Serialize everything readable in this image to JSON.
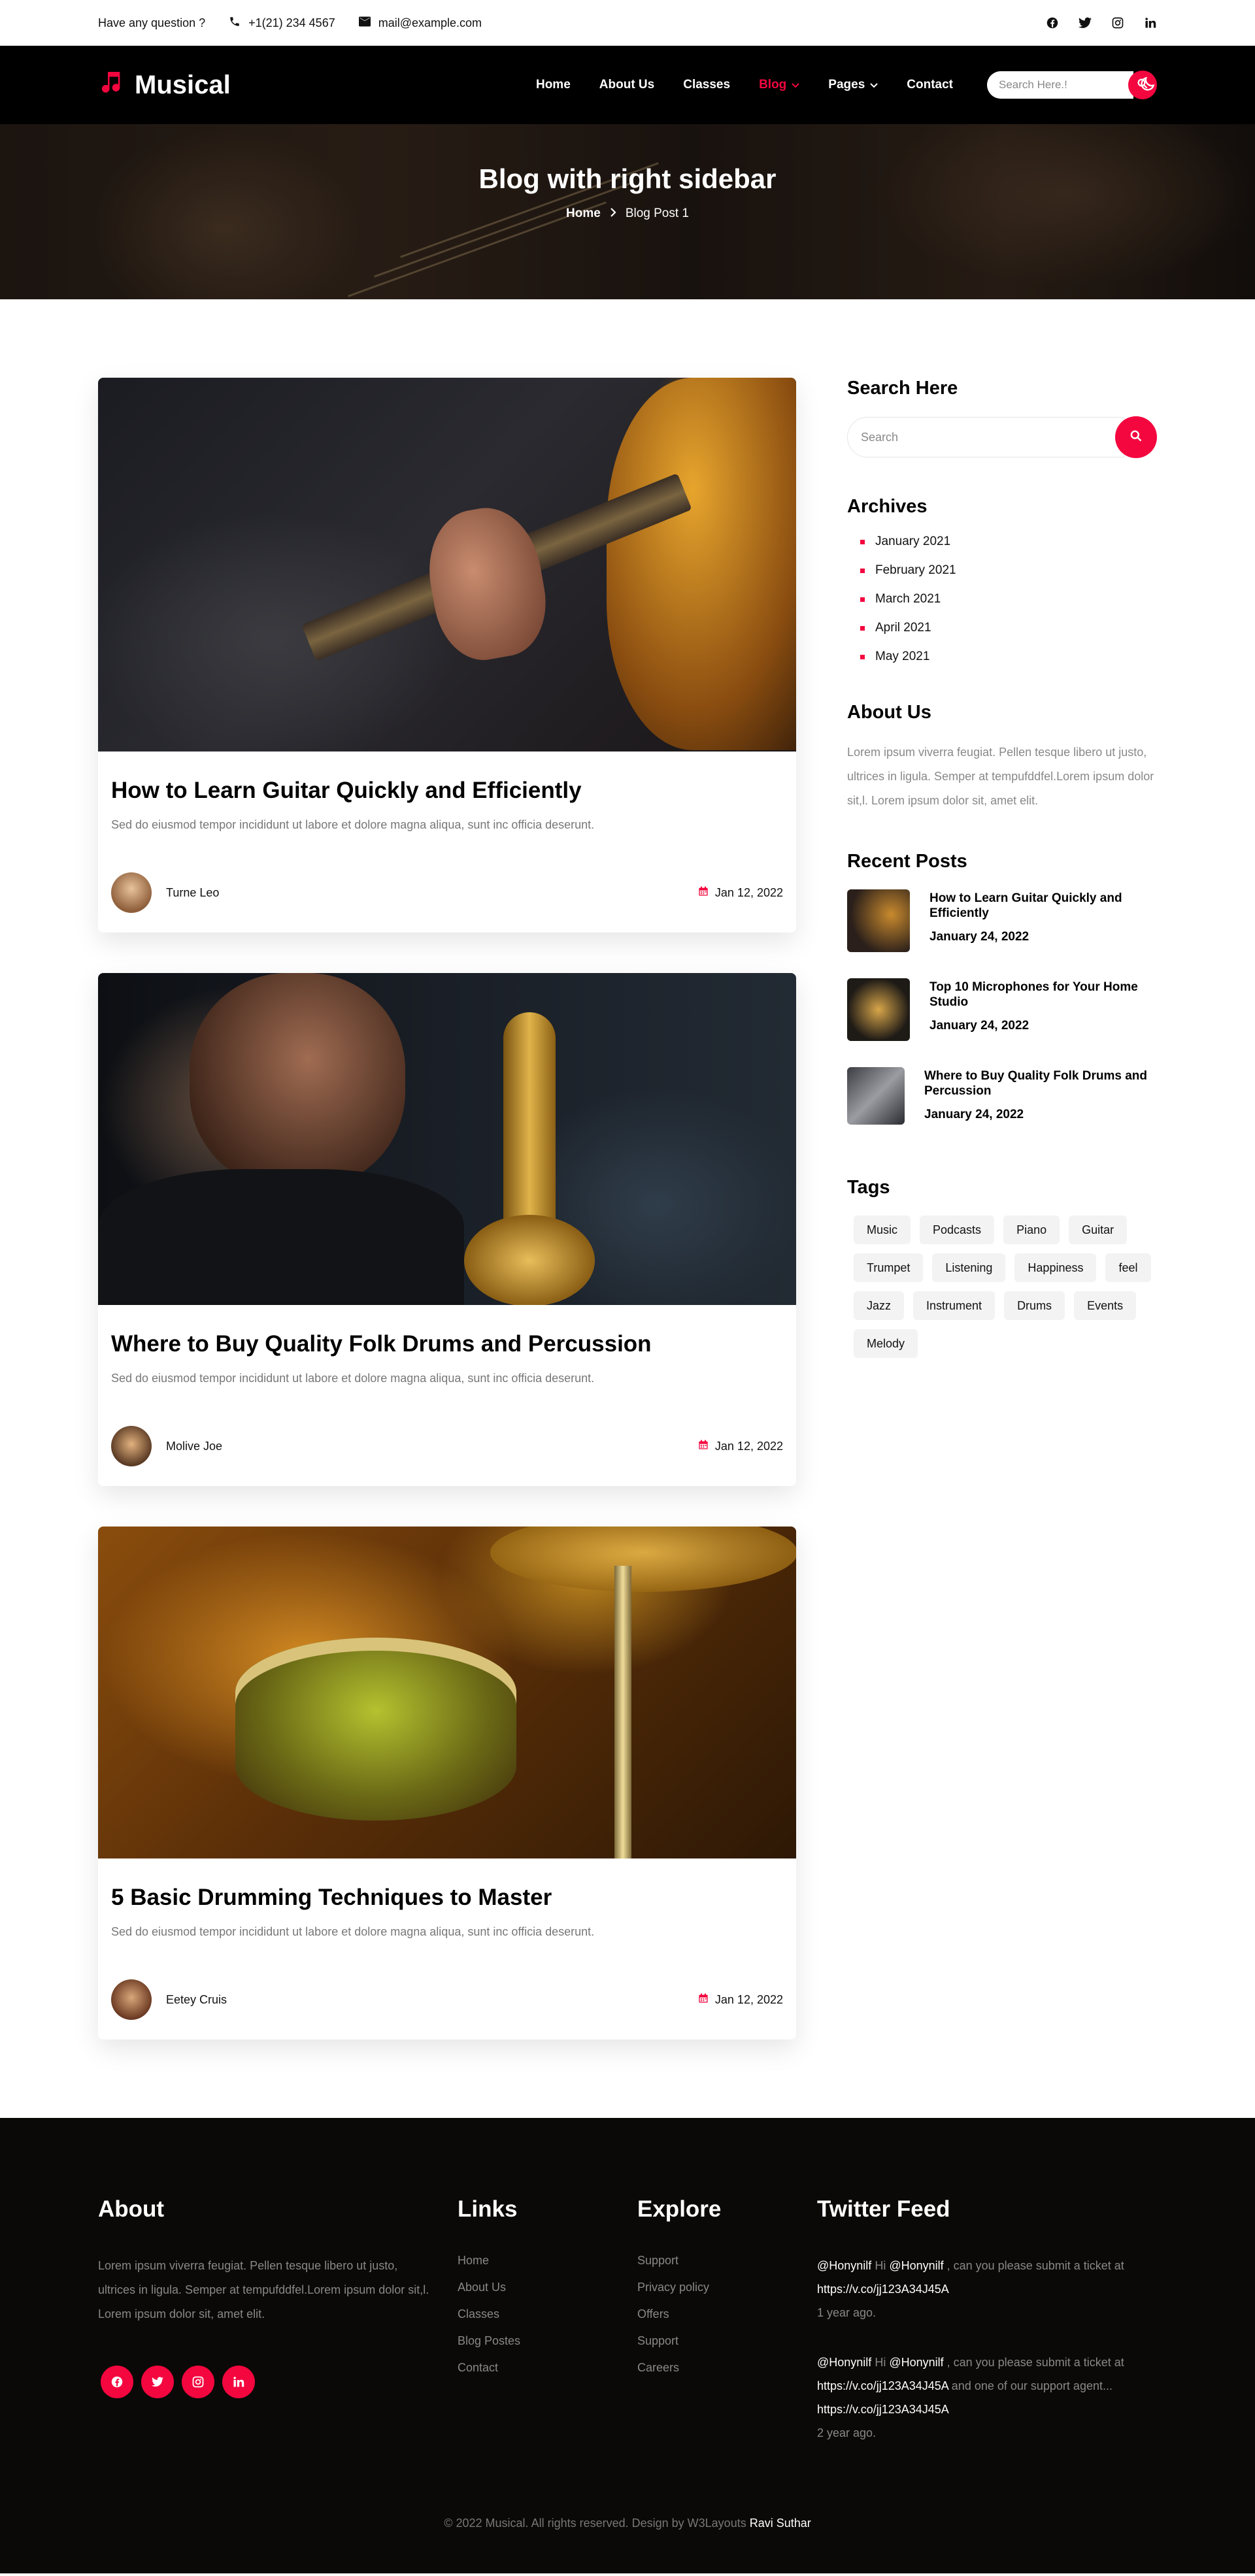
{
  "topbar": {
    "question": "Have any question ?",
    "phone": "+1(21) 234 4567",
    "email": "mail@example.com",
    "social_icons": [
      "facebook-icon",
      "twitter-icon",
      "instagram-icon",
      "linkedin-icon"
    ]
  },
  "nav": {
    "logo": "Musical",
    "items": [
      {
        "label": "Home"
      },
      {
        "label": "About Us"
      },
      {
        "label": "Classes"
      },
      {
        "label": "Blog"
      },
      {
        "label": "Pages"
      },
      {
        "label": "Contact"
      }
    ],
    "search_placeholder": "Search Here.!",
    "accent": "#f4063f"
  },
  "hero": {
    "title": "Blog with right sidebar",
    "crumb_home": "Home",
    "crumb_current": "Blog Post 1"
  },
  "posts": [
    {
      "title": "How to Learn Guitar Quickly and Efficiently",
      "excerpt": "Sed do eiusmod tempor incididunt ut labore et dolore magna aliqua, sunt inc officia deserunt.",
      "author": "Turne Leo",
      "date": "Jan 12, 2022"
    },
    {
      "title": "Where to Buy Quality Folk Drums and Percussion",
      "excerpt": "Sed do eiusmod tempor incididunt ut labore et dolore magna aliqua, sunt inc officia deserunt.",
      "author": "Molive Joe",
      "date": "Jan 12, 2022"
    },
    {
      "title": "5 Basic Drumming Techniques to Master",
      "excerpt": "Sed do eiusmod tempor incididunt ut labore et dolore magna aliqua, sunt inc officia deserunt.",
      "author": "Eetey Cruis",
      "date": "Jan 12, 2022"
    }
  ],
  "sidebar": {
    "search_title": "Search Here",
    "search_placeholder": "Search",
    "archives_title": "Archives",
    "archives": [
      "January 2021",
      "February 2021",
      "March 2021",
      "April 2021",
      "May 2021"
    ],
    "about_title": "About Us",
    "about_text": "Lorem ipsum viverra feugiat. Pellen tesque libero ut justo, ultrices in ligula. Semper at tempufddfel.Lorem ipsum dolor sit,l. Lorem ipsum dolor sit, amet elit.",
    "recent_title": "Recent Posts",
    "recent": [
      {
        "title": "How to Learn Guitar Quickly and Efficiently",
        "date": "January 24, 2022"
      },
      {
        "title": "Top 10 Microphones for Your Home Studio",
        "date": "January 24, 2022"
      },
      {
        "title": "Where to Buy Quality Folk Drums and Percussion",
        "date": "January 24, 2022"
      }
    ],
    "tags_title": "Tags",
    "tags": [
      "Music",
      "Podcasts",
      "Piano",
      "Guitar",
      "Trumpet",
      "Listening",
      "Happiness",
      "feel",
      "Jazz",
      "Instrument",
      "Drums",
      "Events",
      "Melody"
    ]
  },
  "footer": {
    "about_title": "About",
    "about_text": "Lorem ipsum viverra feugiat. Pellen tesque libero ut justo, ultrices in ligula. Semper at tempufddfel.Lorem ipsum dolor sit,l. Lorem ipsum dolor sit, amet elit.",
    "social_icons": [
      "facebook-icon",
      "twitter-icon",
      "instagram-icon",
      "linkedin-icon"
    ],
    "links_title": "Links",
    "links": [
      "Home",
      "About Us",
      "Classes",
      "Blog Postes",
      "Contact"
    ],
    "explore_title": "Explore",
    "explore": [
      "Support",
      "Privacy policy",
      "Offers",
      "Support",
      "Careers"
    ],
    "twitter_title": "Twitter Feed",
    "tweets": [
      {
        "handle": "@Honynilf",
        "text_a": " Hi ",
        "mention": "@Honynilf",
        "text_b": " , can you please submit a ticket at ",
        "link": "https://v.co/jj123A34J45A",
        "text_c": "",
        "time": "1 year ago."
      },
      {
        "handle": "@Honynilf",
        "text_a": " Hi ",
        "mention": "@Honynilf",
        "text_b": " , can you please submit a ticket at ",
        "link": "https://v.co/jj123A34J45A",
        "text_c": " and one of our support agent... ",
        "link2": "https://v.co/jj123A34J45A",
        "time": "2 year ago."
      }
    ],
    "copyright": "© 2022 Musical. All rights reserved. Design by W3Layouts ",
    "designer": "Ravi Suthar"
  }
}
